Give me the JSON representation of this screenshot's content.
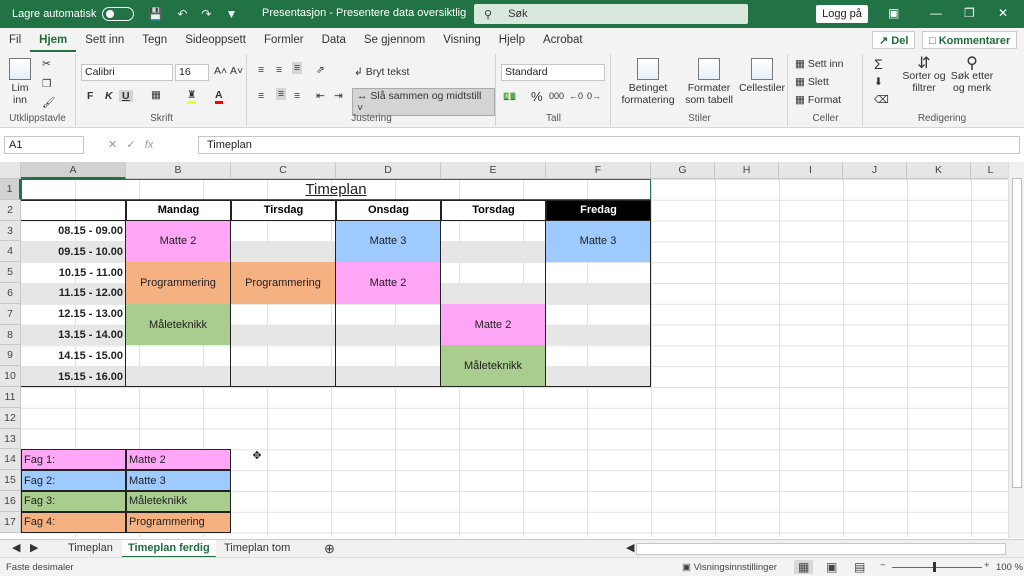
{
  "titlebar": {
    "autosave_label": "Lagre automatisk",
    "autosave_state": "off",
    "doc_title": "Presentasjon  -  Presentere data oversiktlig",
    "search_placeholder": "Søk",
    "login_label": "Logg på"
  },
  "ribbon_tabs": [
    "Fil",
    "Hjem",
    "Sett inn",
    "Tegn",
    "Sideoppsett",
    "Formler",
    "Data",
    "Se gjennom",
    "Visning",
    "Hjelp",
    "Acrobat"
  ],
  "active_tab": "Hjem",
  "share_label": "Del",
  "comments_label": "Kommentarer",
  "ribbon": {
    "clipboard": {
      "paste": "Lim",
      "paste2": "inn",
      "label": "Utklippstavle"
    },
    "font": {
      "name": "Calibri",
      "size": "16",
      "bold": "F",
      "italic": "K",
      "underline": "U",
      "label": "Skrift"
    },
    "alignment": {
      "wrap": "Bryt tekst",
      "merge": "Slå sammen og midtstill",
      "label": "Justering"
    },
    "number": {
      "format": "Standard",
      "label": "Tall"
    },
    "styles": {
      "cond": "Betinget",
      "cond2": "formatering",
      "table": "Formater",
      "table2": "som tabell",
      "cell": "Cellestiler",
      "label": "Stiler"
    },
    "cells": {
      "insert": "Sett inn",
      "delete": "Slett",
      "format": "Format",
      "label": "Celler"
    },
    "editing": {
      "sort": "Sorter og",
      "sort2": "filtrer",
      "find": "Søk etter",
      "find2": "og merk",
      "label": "Redigering"
    }
  },
  "formula_bar": {
    "name_box": "A1",
    "formula": "Timeplan"
  },
  "columns": [
    "A",
    "B",
    "C",
    "D",
    "E",
    "F",
    "G",
    "H",
    "I",
    "J",
    "K",
    "L"
  ],
  "rows": [
    "1",
    "2",
    "3",
    "4",
    "5",
    "6",
    "7",
    "8",
    "9",
    "10",
    "11",
    "12",
    "13",
    "14",
    "15",
    "16",
    "17"
  ],
  "colors": {
    "pink": "#ffa7f6",
    "blue": "#9fcafe",
    "green": "#a9cd8f",
    "orange": "#f6b183",
    "band": "#e6e6e6",
    "black": "#000000"
  },
  "timetable": {
    "title": "Timeplan",
    "days": [
      "Mandag",
      "Tirsdag",
      "Onsdag",
      "Torsdag",
      "Fredag"
    ],
    "times": [
      "08.15 - 09.00",
      "09.15 - 10.00",
      "10.15 - 11.00",
      "11.15 - 12.00",
      "12.15 - 13.00",
      "13.15 - 14.00",
      "14.15 - 15.00",
      "15.15 - 16.00"
    ],
    "blocks": [
      {
        "day": 0,
        "start": 0,
        "span": 2,
        "text": "Matte 2",
        "color": "pink"
      },
      {
        "day": 2,
        "start": 0,
        "span": 2,
        "text": "Matte 3",
        "color": "blue"
      },
      {
        "day": 4,
        "start": 0,
        "span": 2,
        "text": "Matte 3",
        "color": "blue"
      },
      {
        "day": 0,
        "start": 2,
        "span": 2,
        "text": "Programmering",
        "color": "orange"
      },
      {
        "day": 1,
        "start": 2,
        "span": 2,
        "text": "Programmering",
        "color": "orange"
      },
      {
        "day": 2,
        "start": 2,
        "span": 2,
        "text": "Matte 2",
        "color": "pink"
      },
      {
        "day": 0,
        "start": 4,
        "span": 2,
        "text": "Måleteknikk",
        "color": "green"
      },
      {
        "day": 3,
        "start": 4,
        "span": 2,
        "text": "Matte 2",
        "color": "pink"
      },
      {
        "day": 3,
        "start": 6,
        "span": 2,
        "text": "Måleteknikk",
        "color": "green"
      }
    ]
  },
  "legend": [
    {
      "label": "Fag 1:",
      "value": "Matte 2",
      "color": "pink"
    },
    {
      "label": "Fag 2:",
      "value": "Matte 3",
      "color": "blue"
    },
    {
      "label": "Fag 3:",
      "value": "Måleteknikk",
      "color": "green"
    },
    {
      "label": "Fag 4:",
      "value": "Programmering",
      "color": "orange"
    }
  ],
  "sheets": [
    "Timeplan",
    "Timeplan ferdig",
    "Timeplan tom"
  ],
  "active_sheet": "Timeplan ferdig",
  "status": {
    "left": "Faste desimaler",
    "view_settings": "Visningsinnstillinger",
    "zoom": "100 %"
  }
}
